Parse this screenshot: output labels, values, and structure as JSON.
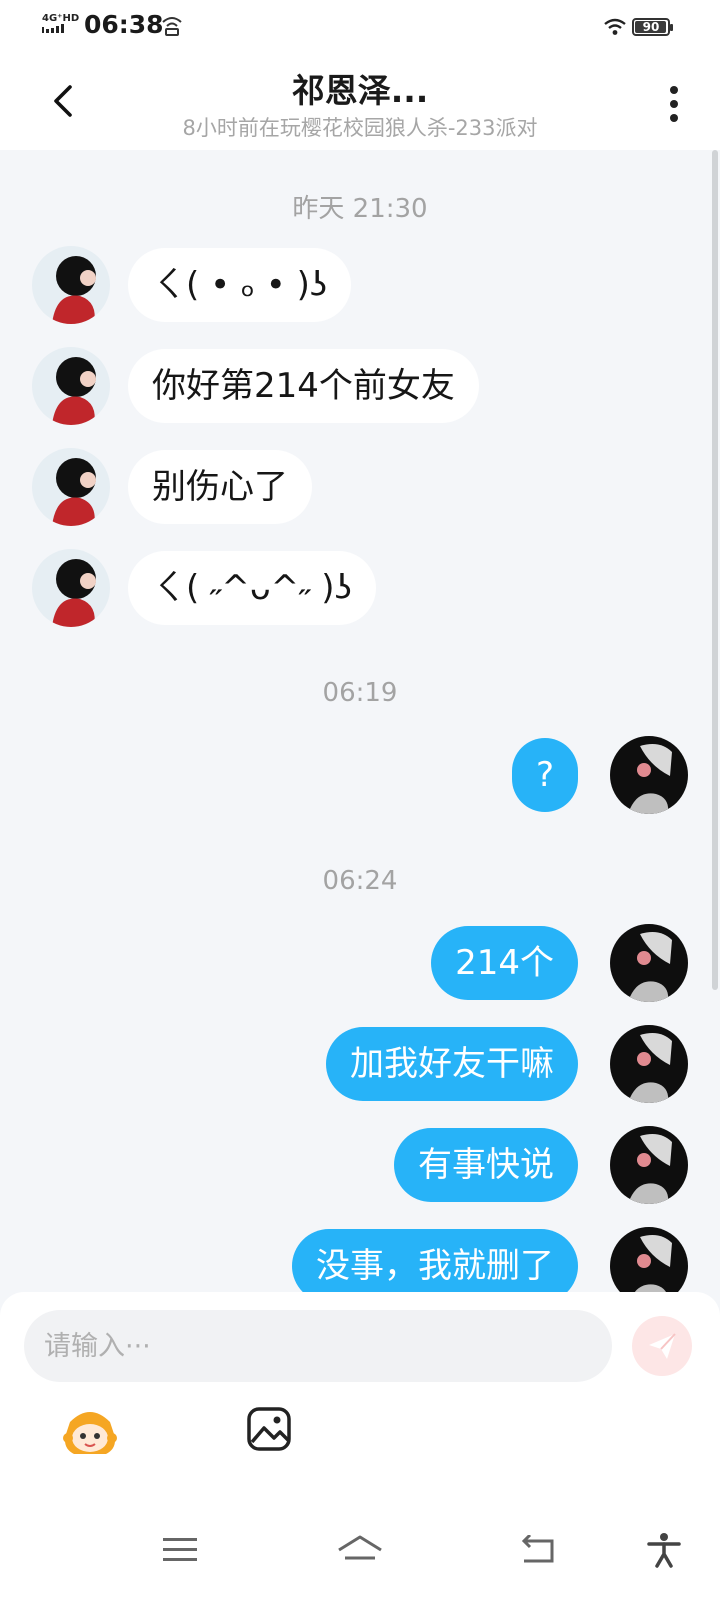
{
  "status_bar": {
    "network": "4G⁺HD",
    "time": "06:38",
    "battery": "90"
  },
  "header": {
    "title": "祁恩泽...",
    "subtitle": "8小时前在玩樱花校园狼人杀-233派对"
  },
  "chat": {
    "timestamps": [
      "昨天 21:30",
      "06:19",
      "06:24"
    ],
    "messages": [
      {
        "side": "in",
        "text": "ㄑ( • ₒ • )ʖ"
      },
      {
        "side": "in",
        "text": "你好第214个前女友"
      },
      {
        "side": "in",
        "text": "别伤心了"
      },
      {
        "side": "in",
        "text": "ㄑ( ˶^ᴗ^˶ )ʖ"
      },
      {
        "side": "out",
        "text": "?"
      },
      {
        "side": "out",
        "text": "214个"
      },
      {
        "side": "out",
        "text": "加我好友干嘛"
      },
      {
        "side": "out",
        "text": "有事快说"
      },
      {
        "side": "out",
        "text": "没事，我就删了"
      }
    ]
  },
  "input": {
    "placeholder": "请输入···"
  },
  "colors": {
    "outgoing_bubble": "#27b3f8",
    "incoming_bubble": "#ffffff",
    "background": "#f4f6f9"
  },
  "icons": [
    "back-arrow-icon",
    "more-vertical-icon",
    "send-icon",
    "emoji-mascot-icon",
    "image-icon",
    "menu-icon",
    "home-icon",
    "back-icon",
    "accessibility-icon"
  ]
}
